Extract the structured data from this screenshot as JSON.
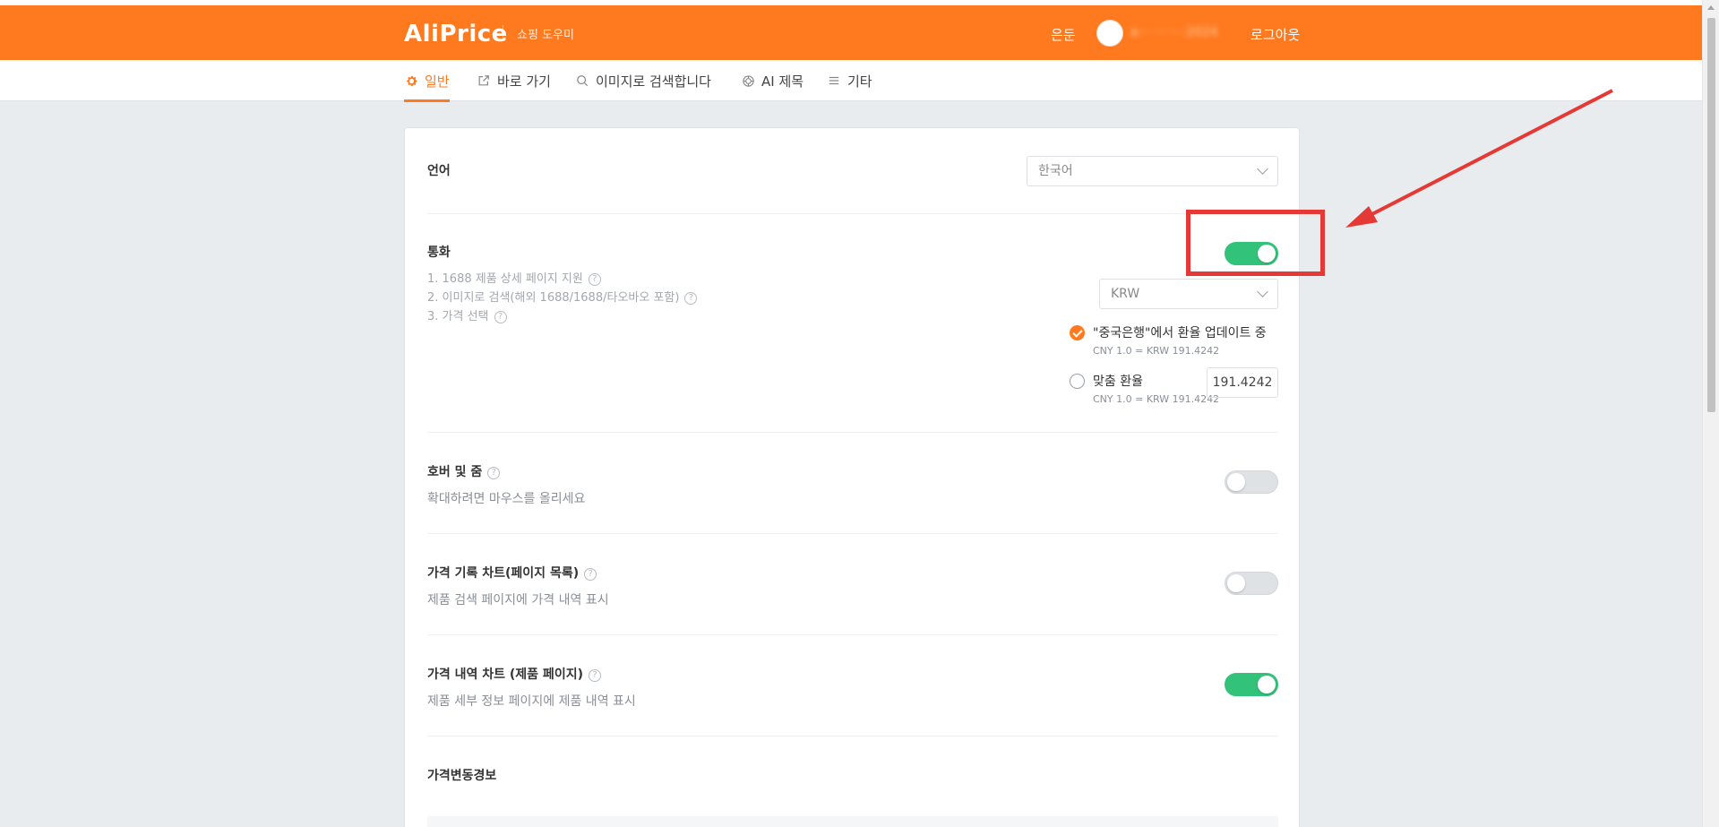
{
  "header": {
    "logo": "AliPrice",
    "subtitle": "쇼핑 도우미",
    "link_left": "은둔",
    "username": "a··· ··· ····2024",
    "logout": "로그아웃"
  },
  "tabs": [
    {
      "label": "일반",
      "icon": "gear-icon",
      "active": true
    },
    {
      "label": "바로 가기",
      "icon": "external-link-icon",
      "active": false
    },
    {
      "label": "이미지로 검색합니다",
      "icon": "search-icon",
      "active": false
    },
    {
      "label": "AI 제목",
      "icon": "ai-icon",
      "active": false
    },
    {
      "label": "기타",
      "icon": "menu-icon",
      "active": false
    }
  ],
  "language": {
    "title": "언어",
    "selected": "한국어"
  },
  "currency": {
    "title": "통화",
    "notes": [
      "1. 1688 제품 상세 페이지 지원",
      "2. 이미지로 검색(해외 1688/1688/타오바오 포함)",
      "3. 가격 선택"
    ],
    "enabled": true,
    "selected": "KRW",
    "option_bank_label": "\"중국은행\"에서 환율 업데이트 중",
    "option_bank_note": "CNY 1.0 = KRW 191.4242",
    "option_custom_label": "맞춤 환율",
    "option_custom_note": "CNY 1.0 = KRW 191.4242",
    "custom_rate_value": "191.4242"
  },
  "hover_zoom": {
    "title": "호버 및 줌",
    "sub": "확대하려면 마우스를 올리세요",
    "enabled": false
  },
  "price_history_list": {
    "title": "가격 기록 차트(페이지 목록)",
    "sub": "제품 검색 페이지에 가격 내역 표시",
    "enabled": false
  },
  "price_history_product": {
    "title": "가격 내역 차트 (제품 페이지)",
    "sub": "제품 세부 정보 페이지에 제품 내역 표시",
    "enabled": true
  },
  "price_alert": {
    "title": "가격변동경보"
  },
  "colors": {
    "brand": "#ff7a1f",
    "toggle_on": "#33c27a",
    "annotation": "#e53935"
  }
}
